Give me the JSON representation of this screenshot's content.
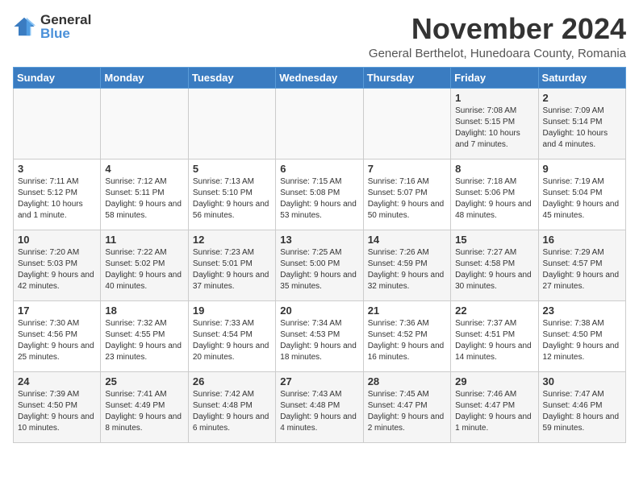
{
  "logo": {
    "general": "General",
    "blue": "Blue"
  },
  "title": "November 2024",
  "subtitle": "General Berthelot, Hunedoara County, Romania",
  "headers": [
    "Sunday",
    "Monday",
    "Tuesday",
    "Wednesday",
    "Thursday",
    "Friday",
    "Saturday"
  ],
  "weeks": [
    [
      {
        "day": "",
        "info": ""
      },
      {
        "day": "",
        "info": ""
      },
      {
        "day": "",
        "info": ""
      },
      {
        "day": "",
        "info": ""
      },
      {
        "day": "",
        "info": ""
      },
      {
        "day": "1",
        "info": "Sunrise: 7:08 AM\nSunset: 5:15 PM\nDaylight: 10 hours and 7 minutes."
      },
      {
        "day": "2",
        "info": "Sunrise: 7:09 AM\nSunset: 5:14 PM\nDaylight: 10 hours and 4 minutes."
      }
    ],
    [
      {
        "day": "3",
        "info": "Sunrise: 7:11 AM\nSunset: 5:12 PM\nDaylight: 10 hours and 1 minute."
      },
      {
        "day": "4",
        "info": "Sunrise: 7:12 AM\nSunset: 5:11 PM\nDaylight: 9 hours and 58 minutes."
      },
      {
        "day": "5",
        "info": "Sunrise: 7:13 AM\nSunset: 5:10 PM\nDaylight: 9 hours and 56 minutes."
      },
      {
        "day": "6",
        "info": "Sunrise: 7:15 AM\nSunset: 5:08 PM\nDaylight: 9 hours and 53 minutes."
      },
      {
        "day": "7",
        "info": "Sunrise: 7:16 AM\nSunset: 5:07 PM\nDaylight: 9 hours and 50 minutes."
      },
      {
        "day": "8",
        "info": "Sunrise: 7:18 AM\nSunset: 5:06 PM\nDaylight: 9 hours and 48 minutes."
      },
      {
        "day": "9",
        "info": "Sunrise: 7:19 AM\nSunset: 5:04 PM\nDaylight: 9 hours and 45 minutes."
      }
    ],
    [
      {
        "day": "10",
        "info": "Sunrise: 7:20 AM\nSunset: 5:03 PM\nDaylight: 9 hours and 42 minutes."
      },
      {
        "day": "11",
        "info": "Sunrise: 7:22 AM\nSunset: 5:02 PM\nDaylight: 9 hours and 40 minutes."
      },
      {
        "day": "12",
        "info": "Sunrise: 7:23 AM\nSunset: 5:01 PM\nDaylight: 9 hours and 37 minutes."
      },
      {
        "day": "13",
        "info": "Sunrise: 7:25 AM\nSunset: 5:00 PM\nDaylight: 9 hours and 35 minutes."
      },
      {
        "day": "14",
        "info": "Sunrise: 7:26 AM\nSunset: 4:59 PM\nDaylight: 9 hours and 32 minutes."
      },
      {
        "day": "15",
        "info": "Sunrise: 7:27 AM\nSunset: 4:58 PM\nDaylight: 9 hours and 30 minutes."
      },
      {
        "day": "16",
        "info": "Sunrise: 7:29 AM\nSunset: 4:57 PM\nDaylight: 9 hours and 27 minutes."
      }
    ],
    [
      {
        "day": "17",
        "info": "Sunrise: 7:30 AM\nSunset: 4:56 PM\nDaylight: 9 hours and 25 minutes."
      },
      {
        "day": "18",
        "info": "Sunrise: 7:32 AM\nSunset: 4:55 PM\nDaylight: 9 hours and 23 minutes."
      },
      {
        "day": "19",
        "info": "Sunrise: 7:33 AM\nSunset: 4:54 PM\nDaylight: 9 hours and 20 minutes."
      },
      {
        "day": "20",
        "info": "Sunrise: 7:34 AM\nSunset: 4:53 PM\nDaylight: 9 hours and 18 minutes."
      },
      {
        "day": "21",
        "info": "Sunrise: 7:36 AM\nSunset: 4:52 PM\nDaylight: 9 hours and 16 minutes."
      },
      {
        "day": "22",
        "info": "Sunrise: 7:37 AM\nSunset: 4:51 PM\nDaylight: 9 hours and 14 minutes."
      },
      {
        "day": "23",
        "info": "Sunrise: 7:38 AM\nSunset: 4:50 PM\nDaylight: 9 hours and 12 minutes."
      }
    ],
    [
      {
        "day": "24",
        "info": "Sunrise: 7:39 AM\nSunset: 4:50 PM\nDaylight: 9 hours and 10 minutes."
      },
      {
        "day": "25",
        "info": "Sunrise: 7:41 AM\nSunset: 4:49 PM\nDaylight: 9 hours and 8 minutes."
      },
      {
        "day": "26",
        "info": "Sunrise: 7:42 AM\nSunset: 4:48 PM\nDaylight: 9 hours and 6 minutes."
      },
      {
        "day": "27",
        "info": "Sunrise: 7:43 AM\nSunset: 4:48 PM\nDaylight: 9 hours and 4 minutes."
      },
      {
        "day": "28",
        "info": "Sunrise: 7:45 AM\nSunset: 4:47 PM\nDaylight: 9 hours and 2 minutes."
      },
      {
        "day": "29",
        "info": "Sunrise: 7:46 AM\nSunset: 4:47 PM\nDaylight: 9 hours and 1 minute."
      },
      {
        "day": "30",
        "info": "Sunrise: 7:47 AM\nSunset: 4:46 PM\nDaylight: 8 hours and 59 minutes."
      }
    ]
  ]
}
